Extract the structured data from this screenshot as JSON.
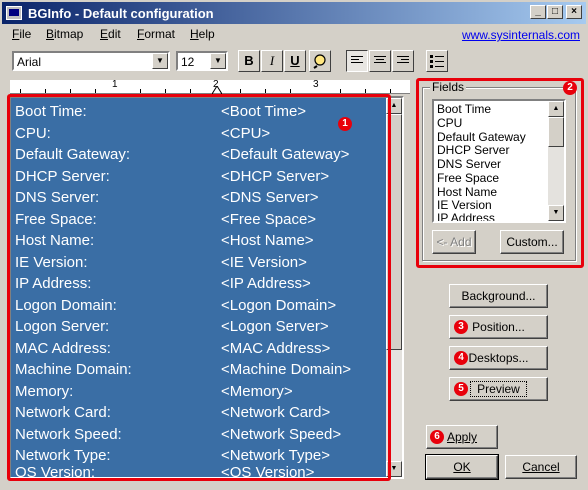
{
  "window": {
    "title": "BGInfo - Default configuration",
    "buttons": {
      "minimize": "_",
      "maximize": "□",
      "close": "×"
    }
  },
  "menu": {
    "items": [
      {
        "label": "File",
        "accel": "F",
        "rest": "ile"
      },
      {
        "label": "Bitmap",
        "accel": "B",
        "rest": "itmap"
      },
      {
        "label": "Edit",
        "accel": "E",
        "rest": "dit"
      },
      {
        "label": "Format",
        "accel": "F",
        "rest": "ormat"
      },
      {
        "label": "Help",
        "accel": "H",
        "rest": "elp"
      }
    ],
    "link": "www.sysinternals.com"
  },
  "toolbar": {
    "font": "Arial",
    "size": "12",
    "bold": "B",
    "italic": "I",
    "underline": "U"
  },
  "ruler": {
    "marks": [
      "1",
      "2",
      "3"
    ]
  },
  "editor": {
    "rows": [
      {
        "label": "Boot Time:",
        "value": "<Boot Time>"
      },
      {
        "label": "CPU:",
        "value": "<CPU>"
      },
      {
        "label": "Default Gateway:",
        "value": "<Default Gateway>"
      },
      {
        "label": "DHCP Server:",
        "value": "<DHCP Server>"
      },
      {
        "label": "DNS Server:",
        "value": "<DNS Server>"
      },
      {
        "label": "Free Space:",
        "value": "<Free Space>"
      },
      {
        "label": "Host Name:",
        "value": "<Host Name>"
      },
      {
        "label": "IE Version:",
        "value": "<IE Version>"
      },
      {
        "label": "IP Address:",
        "value": "<IP Address>"
      },
      {
        "label": "Logon Domain:",
        "value": "<Logon Domain>"
      },
      {
        "label": "Logon Server:",
        "value": "<Logon Server>"
      },
      {
        "label": "MAC Address:",
        "value": "<MAC Address>"
      },
      {
        "label": "Machine Domain:",
        "value": "<Machine Domain>"
      },
      {
        "label": "Memory:",
        "value": "<Memory>"
      },
      {
        "label": "Network Card:",
        "value": "<Network Card>"
      },
      {
        "label": "Network Speed:",
        "value": "<Network Speed>"
      },
      {
        "label": "Network Type:",
        "value": "<Network Type>"
      },
      {
        "label": "OS Version:",
        "value": "<OS Version>"
      }
    ]
  },
  "fields": {
    "group_label": "Fields",
    "items": [
      "Boot Time",
      "CPU",
      "Default Gateway",
      "DHCP Server",
      "DNS Server",
      "Free Space",
      "Host Name",
      "IE Version",
      "IP Address"
    ],
    "add_label": "<- Add",
    "custom_label": "Custom..."
  },
  "buttons": {
    "background": "Background...",
    "position": "Position...",
    "desktops": "Desktops...",
    "preview": "Preview",
    "apply": "Apply",
    "ok": "OK",
    "cancel": "Cancel"
  },
  "annotations": {
    "badges": [
      "1",
      "2",
      "3",
      "4",
      "5",
      "6"
    ],
    "color": "#e8000b"
  },
  "colors": {
    "editor_background": "#3a6ea5",
    "titlebar_start": "#0a246a",
    "face": "#d4d0c8"
  }
}
